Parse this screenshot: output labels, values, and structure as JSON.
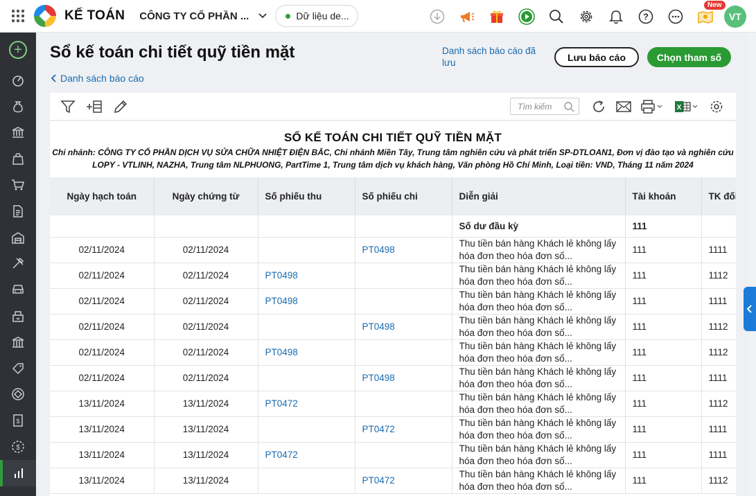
{
  "app": {
    "name": "KẾ TOÁN",
    "company": "CÔNG TY CỔ PHẦN ...",
    "data_status": "Dữ liệu de...",
    "avatar": "VT",
    "new_badge": "New"
  },
  "page": {
    "title": "Sổ kế toán chi tiết quỹ tiền mặt",
    "back_label": "Danh sách báo cáo",
    "saved_reports": "Danh sách báo cáo đã lưu",
    "save_button": "Lưu báo cáo",
    "choose_button": "Chọn tham số"
  },
  "toolbar": {
    "search_placeholder": "Tìm kiếm"
  },
  "report": {
    "title": "SỔ KẾ TOÁN CHI TIẾT QUỸ TIỀN MẶT",
    "subtitle": "Chi nhánh: CÔNG TY CỔ PHẦN DỊCH VỤ SỬA CHỮA NHIỆT ĐIỆN BẮC, Chi nhánh Miền Tây, Trung tâm nghiên cứu và phát triển SP-DTLOAN1, Đơn vị đào tạo và nghiên cứu LOPY - VTLINH, NAZHA, Trung tâm NLPHUONG, PartTime 1, Trung tâm dịch vụ khách hàng, Văn phòng Hồ Chí Minh, Loại tiền: VND, Tháng 11 năm 2024",
    "columns": [
      "Ngày hạch toán",
      "Ngày chứng từ",
      "Số phiếu thu",
      "Số phiếu chi",
      "Diễn giải",
      "Tài khoản",
      "TK đối"
    ],
    "opening": {
      "label": "Số dư đầu kỳ",
      "account": "111"
    },
    "rows": [
      {
        "post_date": "02/11/2024",
        "doc_date": "02/11/2024",
        "receipt": "",
        "payment": "PT0498",
        "desc": "Thu tiền bán hàng Khách lẻ không lấy hóa đơn theo hóa đơn số...",
        "account": "111",
        "counter": "1111"
      },
      {
        "post_date": "02/11/2024",
        "doc_date": "02/11/2024",
        "receipt": "PT0498",
        "payment": "",
        "desc": "Thu tiền bán hàng Khách lẻ không lấy hóa đơn theo hóa đơn số...",
        "account": "111",
        "counter": "1112"
      },
      {
        "post_date": "02/11/2024",
        "doc_date": "02/11/2024",
        "receipt": "PT0498",
        "payment": "",
        "desc": "Thu tiền bán hàng Khách lẻ không lấy hóa đơn theo hóa đơn số...",
        "account": "111",
        "counter": "1111"
      },
      {
        "post_date": "02/11/2024",
        "doc_date": "02/11/2024",
        "receipt": "",
        "payment": "PT0498",
        "desc": "Thu tiền bán hàng Khách lẻ không lấy hóa đơn theo hóa đơn số...",
        "account": "111",
        "counter": "1112"
      },
      {
        "post_date": "02/11/2024",
        "doc_date": "02/11/2024",
        "receipt": "PT0498",
        "payment": "",
        "desc": "Thu tiền bán hàng Khách lẻ không lấy hóa đơn theo hóa đơn số...",
        "account": "111",
        "counter": "1112"
      },
      {
        "post_date": "02/11/2024",
        "doc_date": "02/11/2024",
        "receipt": "",
        "payment": "PT0498",
        "desc": "Thu tiền bán hàng Khách lẻ không lấy hóa đơn theo hóa đơn số...",
        "account": "111",
        "counter": "1111"
      },
      {
        "post_date": "13/11/2024",
        "doc_date": "13/11/2024",
        "receipt": "PT0472",
        "payment": "",
        "desc": "Thu tiền bán hàng Khách lẻ không lấy hóa đơn theo hóa đơn số...",
        "account": "111",
        "counter": "1112"
      },
      {
        "post_date": "13/11/2024",
        "doc_date": "13/11/2024",
        "receipt": "",
        "payment": "PT0472",
        "desc": "Thu tiền bán hàng Khách lẻ không lấy hóa đơn theo hóa đơn số...",
        "account": "111",
        "counter": "1111"
      },
      {
        "post_date": "13/11/2024",
        "doc_date": "13/11/2024",
        "receipt": "PT0472",
        "payment": "",
        "desc": "Thu tiền bán hàng Khách lẻ không lấy hóa đơn theo hóa đơn số...",
        "account": "111",
        "counter": "1111"
      },
      {
        "post_date": "13/11/2024",
        "doc_date": "13/11/2024",
        "receipt": "",
        "payment": "PT0472",
        "desc": "Thu tiền bán hàng Khách lẻ không lấy hóa đơn theo hóa đơn số...",
        "account": "111",
        "counter": "1112"
      }
    ]
  },
  "colors": {
    "accent_green": "#2a9a33",
    "link_blue": "#1a6bb0",
    "sidebar_bg": "#2f3136"
  },
  "icons": {
    "top": [
      "download-icon",
      "megaphone-icon",
      "gift-icon",
      "play-icon",
      "search-icon",
      "gear-icon",
      "bell-icon",
      "help-icon",
      "more-icon",
      "map-icon"
    ],
    "sidebar": [
      "dashboard-icon",
      "money-bag-icon",
      "bank-icon",
      "bag-icon",
      "cart-icon",
      "document-icon",
      "warehouse-icon",
      "tools-icon",
      "car-icon",
      "payroll-icon",
      "tax-icon",
      "tag-icon",
      "budget-icon",
      "invoice-icon",
      "dollar-icon",
      "report-icon"
    ]
  }
}
